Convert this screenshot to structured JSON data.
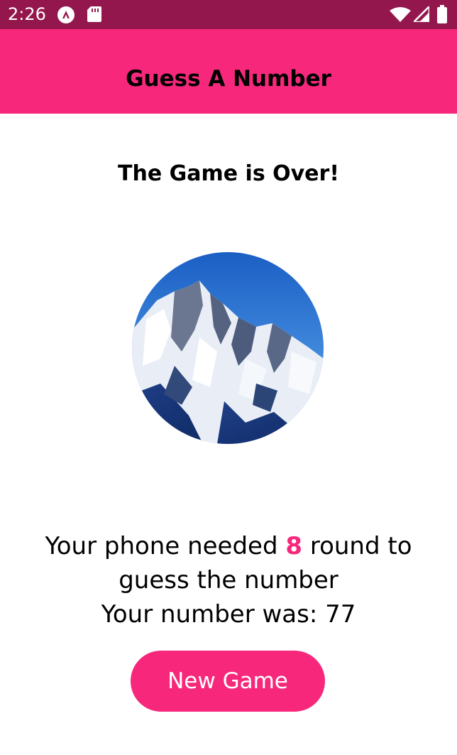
{
  "status_bar": {
    "time": "2:26",
    "icons": [
      "app-notification-icon",
      "sd-card-icon",
      "wifi-icon",
      "cellular-signal-icon",
      "battery-icon"
    ],
    "background": "#93174d"
  },
  "header": {
    "title": "Guess A Number",
    "background": "#f7287b"
  },
  "main": {
    "heading": "The Game is Over!",
    "image_alt": "mountain-image",
    "summary": {
      "part1": "Your phone needed ",
      "rounds": "8",
      "part2": " round to guess the number",
      "number_line": "Your number was: 77"
    },
    "button_label": "New Game"
  },
  "colors": {
    "accent": "#f7287b",
    "status_bar": "#93174d"
  }
}
